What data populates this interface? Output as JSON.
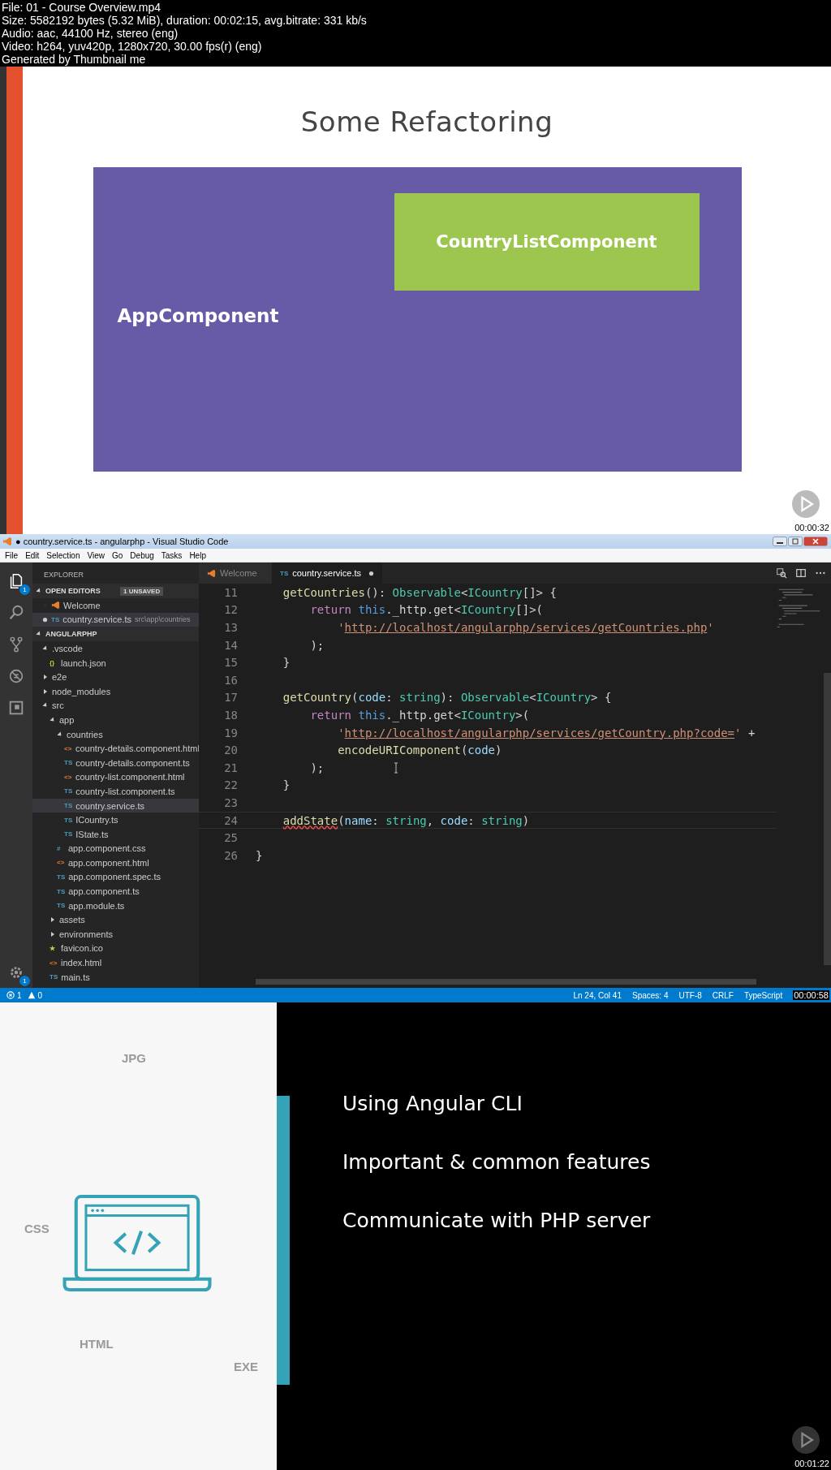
{
  "info_header": {
    "lines": [
      "File: 01 - Course Overview.mp4",
      "Size: 5582192 bytes (5.32 MiB), duration: 00:02:15, avg.bitrate: 331 kb/s",
      "Audio: aac, 44100 Hz, stereo (eng)",
      "Video: h264, yuv420p, 1280x720, 30.00 fps(r) (eng)",
      "Generated by Thumbnail me"
    ]
  },
  "frame_1": {
    "title": "Some Refactoring",
    "outer_box": "AppComponent",
    "inner_box": "CountryListComponent",
    "timestamp": "00:00:32"
  },
  "frame_2": {
    "window": {
      "title": "● country.service.ts - angularphp - Visual Studio Code"
    },
    "menu": [
      "File",
      "Edit",
      "Selection",
      "View",
      "Go",
      "Debug",
      "Tasks",
      "Help"
    ],
    "activity_badges": {
      "explorer": "1",
      "settings": "1"
    },
    "explorer": {
      "title": "EXPLORER",
      "open_editors": {
        "label": "OPEN EDITORS",
        "badge": "1 UNSAVED",
        "expanded": true,
        "items": [
          {
            "label": "Welcome",
            "kind": "vscode",
            "selected": false,
            "dirty": false
          },
          {
            "label": "country.service.ts",
            "icon": "TS",
            "kind": "ts",
            "path": "src\\app\\countries",
            "selected": true,
            "dirty": true
          }
        ]
      },
      "project": {
        "label": "ANGULARPHP",
        "expanded": true,
        "children": [
          {
            "label": ".vscode",
            "kind": "folder",
            "expanded": true,
            "selected": false,
            "children": [
              {
                "label": "launch.json",
                "icon": "{}",
                "kind": "json",
                "selected": false
              }
            ]
          },
          {
            "label": "e2e",
            "kind": "folder",
            "expanded": false,
            "selected": false
          },
          {
            "label": "node_modules",
            "kind": "folder",
            "expanded": false,
            "selected": false
          },
          {
            "label": "src",
            "kind": "folder",
            "expanded": true,
            "selected": false,
            "children": [
              {
                "label": "app",
                "kind": "folder",
                "expanded": true,
                "selected": false,
                "children": [
                  {
                    "label": "countries",
                    "kind": "folder",
                    "expanded": true,
                    "selected": false,
                    "children": [
                      {
                        "label": "country-details.component.html",
                        "icon": "<>",
                        "kind": "html",
                        "selected": false
                      },
                      {
                        "label": "country-details.component.ts",
                        "icon": "TS",
                        "kind": "ts",
                        "selected": false
                      },
                      {
                        "label": "country-list.component.html",
                        "icon": "<>",
                        "kind": "html",
                        "selected": false
                      },
                      {
                        "label": "country-list.component.ts",
                        "icon": "TS",
                        "kind": "ts",
                        "selected": false
                      },
                      {
                        "label": "country.service.ts",
                        "icon": "TS",
                        "kind": "ts",
                        "selected": true
                      },
                      {
                        "label": "ICountry.ts",
                        "icon": "TS",
                        "kind": "ts",
                        "selected": false
                      },
                      {
                        "label": "IState.ts",
                        "icon": "TS",
                        "kind": "ts",
                        "selected": false
                      }
                    ]
                  },
                  {
                    "label": "app.component.css",
                    "icon": "#",
                    "kind": "css",
                    "selected": false
                  },
                  {
                    "label": "app.component.html",
                    "icon": "<>",
                    "kind": "html",
                    "selected": false
                  },
                  {
                    "label": "app.component.spec.ts",
                    "icon": "TS",
                    "kind": "ts",
                    "selected": false
                  },
                  {
                    "label": "app.component.ts",
                    "icon": "TS",
                    "kind": "ts",
                    "selected": false
                  },
                  {
                    "label": "app.module.ts",
                    "icon": "TS",
                    "kind": "ts",
                    "selected": false
                  }
                ]
              },
              {
                "label": "assets",
                "kind": "folder",
                "expanded": false,
                "selected": false
              },
              {
                "label": "environments",
                "kind": "folder",
                "expanded": false,
                "selected": false
              },
              {
                "label": "favicon.ico",
                "icon": "★",
                "kind": "star",
                "selected": false
              },
              {
                "label": "index.html",
                "icon": "<>",
                "kind": "html",
                "selected": false
              },
              {
                "label": "main.ts",
                "icon": "TS",
                "kind": "ts",
                "selected": false
              }
            ]
          }
        ]
      }
    },
    "tabs": [
      {
        "label": "Welcome",
        "kind": "vscode",
        "selected": false,
        "dirty": false
      },
      {
        "label": "country.service.ts",
        "icon": "TS",
        "kind": "ts",
        "selected": true,
        "dirty": true
      }
    ],
    "code": [
      {
        "number": "11",
        "current": false,
        "segments": [
          {
            "kind": "fn",
            "text": "    getCountries"
          },
          {
            "kind": "punc",
            "text": "(): "
          },
          {
            "kind": "type",
            "text": "Observable"
          },
          {
            "kind": "punc",
            "text": "<"
          },
          {
            "kind": "type",
            "text": "ICountry"
          },
          {
            "kind": "punc",
            "text": "[]> {"
          }
        ]
      },
      {
        "number": "12",
        "current": false,
        "segments": [
          {
            "kind": "kw",
            "text": "        return "
          },
          {
            "kind": "this",
            "text": "this"
          },
          {
            "kind": "plain",
            "text": "._http.get<"
          },
          {
            "kind": "type",
            "text": "ICountry"
          },
          {
            "kind": "plain",
            "text": "[]>("
          }
        ]
      },
      {
        "number": "13",
        "current": false,
        "segments": [
          {
            "kind": "str",
            "text": "            '"
          },
          {
            "kind": "url",
            "text": "http://localhost/angularphp/services/getCountries.php"
          },
          {
            "kind": "str",
            "text": "'"
          }
        ]
      },
      {
        "number": "14",
        "current": false,
        "segments": [
          {
            "kind": "plain",
            "text": "        );"
          }
        ]
      },
      {
        "number": "15",
        "current": false,
        "segments": [
          {
            "kind": "plain",
            "text": "    }"
          }
        ]
      },
      {
        "number": "16",
        "current": false
      },
      {
        "number": "17",
        "current": false,
        "segments": [
          {
            "kind": "fn",
            "text": "    getCountry"
          },
          {
            "kind": "punc",
            "text": "("
          },
          {
            "kind": "param",
            "text": "code"
          },
          {
            "kind": "punc",
            "text": ": "
          },
          {
            "kind": "type",
            "text": "string"
          },
          {
            "kind": "punc",
            "text": "): "
          },
          {
            "kind": "type",
            "text": "Observable"
          },
          {
            "kind": "punc",
            "text": "<"
          },
          {
            "kind": "type",
            "text": "ICountry"
          },
          {
            "kind": "punc",
            "text": "> {"
          }
        ]
      },
      {
        "number": "18",
        "current": false,
        "segments": [
          {
            "kind": "kw",
            "text": "        return "
          },
          {
            "kind": "this",
            "text": "this"
          },
          {
            "kind": "plain",
            "text": "._http.get<"
          },
          {
            "kind": "type",
            "text": "ICountry"
          },
          {
            "kind": "plain",
            "text": ">("
          }
        ]
      },
      {
        "number": "19",
        "current": false,
        "segments": [
          {
            "kind": "str",
            "text": "            '"
          },
          {
            "kind": "url",
            "text": "http://localhost/angularphp/services/getCountry.php?code="
          },
          {
            "kind": "str",
            "text": "'"
          },
          {
            "kind": "plain",
            "text": " +"
          }
        ]
      },
      {
        "number": "20",
        "current": false,
        "segments": [
          {
            "kind": "fn",
            "text": "            encodeURIComponent"
          },
          {
            "kind": "punc",
            "text": "("
          },
          {
            "kind": "param",
            "text": "code"
          },
          {
            "kind": "punc",
            "text": ")"
          }
        ]
      },
      {
        "number": "21",
        "current": false,
        "segments": [
          {
            "kind": "plain",
            "text": "        );"
          }
        ]
      },
      {
        "number": "22",
        "current": false,
        "segments": [
          {
            "kind": "plain",
            "text": "    }"
          }
        ]
      },
      {
        "number": "23",
        "current": false
      },
      {
        "number": "24",
        "current": true,
        "segments": [
          {
            "kind": "fn",
            "text": "    addState",
            "squiggle": true
          },
          {
            "kind": "punc",
            "text": "("
          },
          {
            "kind": "param",
            "text": "name"
          },
          {
            "kind": "punc",
            "text": ": "
          },
          {
            "kind": "type",
            "text": "string"
          },
          {
            "kind": "punc",
            "text": ", "
          },
          {
            "kind": "param",
            "text": "code"
          },
          {
            "kind": "punc",
            "text": ": "
          },
          {
            "kind": "type",
            "text": "string"
          },
          {
            "kind": "punc",
            "text": ")"
          }
        ]
      },
      {
        "number": "25",
        "current": false
      },
      {
        "number": "26",
        "current": false,
        "segments": [
          {
            "kind": "plain",
            "text": "}"
          }
        ]
      }
    ],
    "status_bar": {
      "errors": "1",
      "warnings": "0",
      "items": [
        "Ln 24, Col 41",
        "Spaces: 4",
        "UTF-8",
        "CRLF",
        "TypeScript"
      ]
    },
    "timestamp": "00:00:58"
  },
  "frame_3": {
    "pattern_labels": [
      "JPG",
      "CSS",
      "HTML",
      "EXE"
    ],
    "bullets": [
      "Using Angular CLI",
      "Important & common features",
      "Communicate with PHP server"
    ],
    "timestamp": "00:01:22"
  }
}
